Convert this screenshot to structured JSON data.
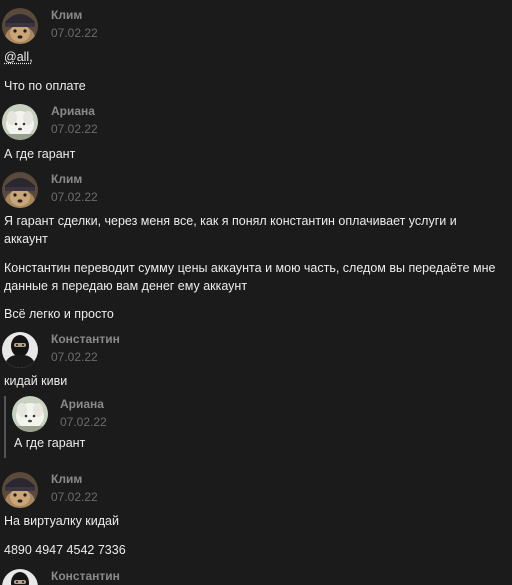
{
  "messages": [
    {
      "author": "Клим",
      "date": "07.02.22",
      "avatar_icon": "dog-in-beanie-avatar",
      "lines": [
        "@all,",
        "Что по оплате"
      ]
    },
    {
      "author": "Ариана",
      "date": "07.02.22",
      "avatar_icon": "white-puppy-avatar",
      "lines": [
        "А где гарант"
      ]
    },
    {
      "author": "Клим",
      "date": "07.02.22",
      "avatar_icon": "dog-in-beanie-avatar",
      "lines": [
        "Я гарант сделки, через меня все, как я понял константин оплачивает услуги и аккаунт",
        "Константин переводит сумму цены аккаунта и мою часть, следом вы передаёте мне данные я передаю вам денег ему аккаунт",
        "Всё легко и просто"
      ]
    },
    {
      "author": "Константин",
      "date": "07.02.22",
      "avatar_icon": "masked-man-avatar",
      "lines": [
        "кидай киви"
      ],
      "quote": {
        "author": "Ариана",
        "date": "07.02.22",
        "text": "А где гарант"
      }
    },
    {
      "author": "Клим",
      "date": "07.02.22",
      "avatar_icon": "dog-in-beanie-avatar",
      "lines": [
        "На виртуалку кидай",
        "4890 4947 4542 7336"
      ]
    },
    {
      "author": "Константин",
      "avatar_icon": "masked-man-avatar"
    }
  ]
}
